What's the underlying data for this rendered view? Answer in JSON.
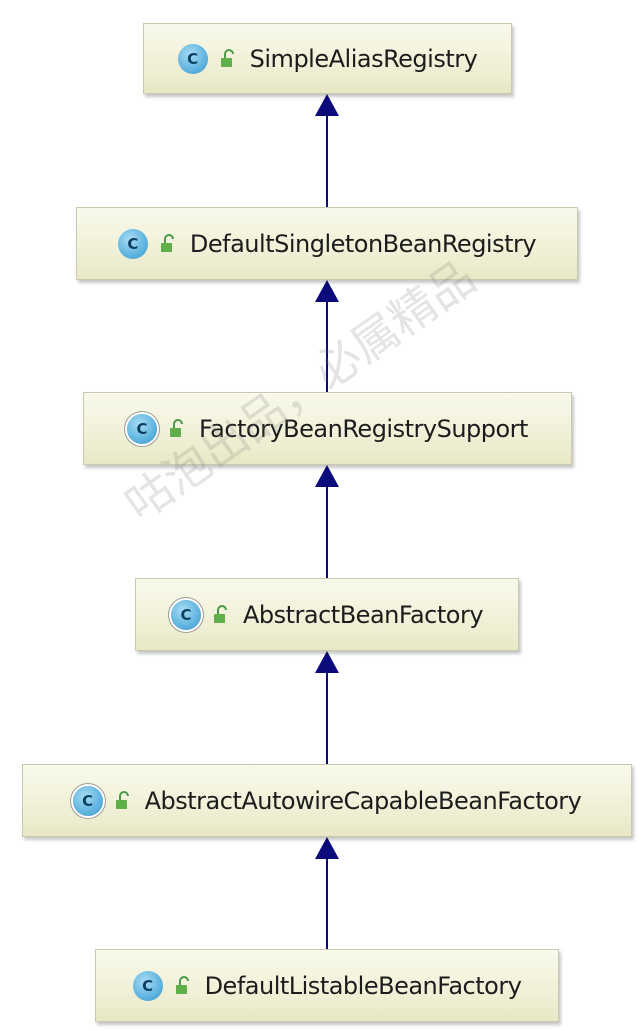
{
  "diagram": {
    "nodes": [
      {
        "id": "n1",
        "label": "SimpleAliasRegistry",
        "icon": "class-icon",
        "access_icon": "public-lock-icon",
        "abstract": false
      },
      {
        "id": "n2",
        "label": "DefaultSingletonBeanRegistry",
        "icon": "class-icon",
        "access_icon": "public-lock-icon",
        "abstract": false
      },
      {
        "id": "n3",
        "label": "FactoryBeanRegistrySupport",
        "icon": "abstract-class-icon",
        "access_icon": "public-lock-icon",
        "abstract": true
      },
      {
        "id": "n4",
        "label": "AbstractBeanFactory",
        "icon": "abstract-class-icon",
        "access_icon": "public-lock-icon",
        "abstract": true
      },
      {
        "id": "n5",
        "label": "AbstractAutowireCapableBeanFactory",
        "icon": "abstract-class-icon",
        "access_icon": "public-lock-icon",
        "abstract": true
      },
      {
        "id": "n6",
        "label": "DefaultListableBeanFactory",
        "icon": "class-icon",
        "access_icon": "public-lock-icon",
        "abstract": false
      }
    ],
    "edges": [
      {
        "from": "n2",
        "to": "n1",
        "type": "extends"
      },
      {
        "from": "n3",
        "to": "n2",
        "type": "extends"
      },
      {
        "from": "n4",
        "to": "n3",
        "type": "extends"
      },
      {
        "from": "n5",
        "to": "n4",
        "type": "extends"
      },
      {
        "from": "n6",
        "to": "n5",
        "type": "extends"
      }
    ],
    "class_icon_letter": "C",
    "arrow_color": "#0b0b7c"
  },
  "watermark": "咕泡出品，必属精品"
}
